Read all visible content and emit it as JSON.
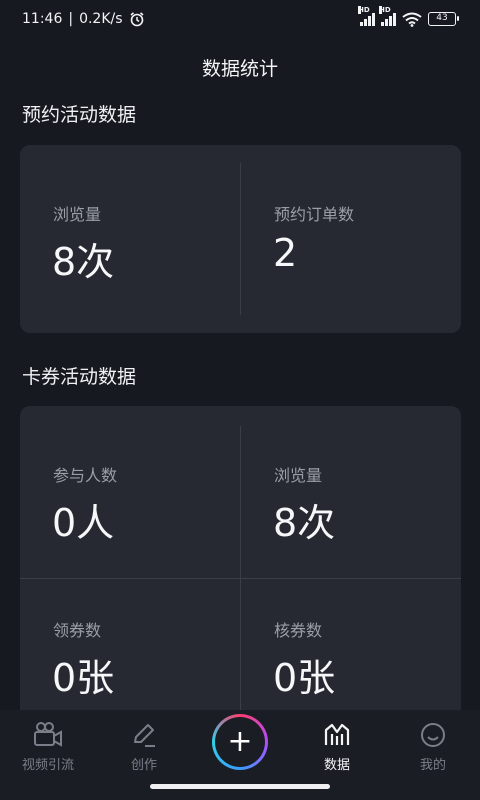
{
  "status_bar": {
    "time": "11:46",
    "net_speed": "0.2K/s",
    "sim1_tag": "HD",
    "sim2_tag": "HD",
    "battery": "43"
  },
  "header": {
    "title": "数据统计"
  },
  "booking": {
    "section_title": "预约活动数据",
    "views": {
      "label": "浏览量",
      "value": "8次"
    },
    "orders": {
      "label": "预约订单数",
      "value": "2"
    }
  },
  "coupon": {
    "section_title": "卡券活动数据",
    "participants": {
      "label": "参与人数",
      "value": "0人"
    },
    "views": {
      "label": "浏览量",
      "value": "8次"
    },
    "claimed": {
      "label": "领券数",
      "value": "0张"
    },
    "redeemed": {
      "label": "核券数",
      "value": "0张"
    }
  },
  "nav": {
    "items": [
      {
        "label": "视频引流",
        "icon": "video-camera-icon"
      },
      {
        "label": "创作",
        "icon": "pencil-icon"
      },
      {
        "label": "",
        "icon": "plus-icon"
      },
      {
        "label": "数据",
        "icon": "chart-icon",
        "active": true
      },
      {
        "label": "我的",
        "icon": "smile-icon"
      }
    ]
  }
}
